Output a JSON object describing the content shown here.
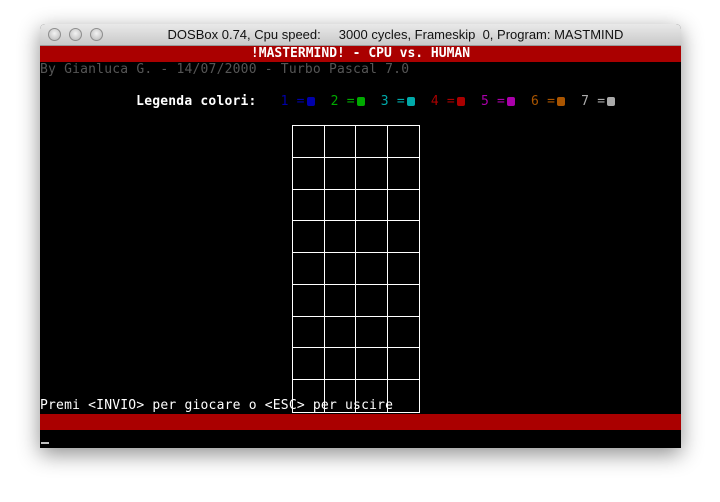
{
  "window": {
    "title": "DOSBox 0.74, Cpu speed:     3000 cycles, Frameskip  0, Program: MASTMIND"
  },
  "screen": {
    "banner": "!MASTERMIND! - CPU vs. HUMAN",
    "credit": "By Gianluca G. - 14/07/2000 - Turbo Pascal 7.0",
    "legend_label": "Legenda colori:",
    "legend": [
      {
        "num": "1",
        "eq": "=",
        "color": "#0000aa"
      },
      {
        "num": "2",
        "eq": "=",
        "color": "#00aa00"
      },
      {
        "num": "3",
        "eq": "=",
        "color": "#00aaaa"
      },
      {
        "num": "4",
        "eq": "=",
        "color": "#aa0000"
      },
      {
        "num": "5",
        "eq": "=",
        "color": "#aa00aa"
      },
      {
        "num": "6",
        "eq": "=",
        "color": "#aa5500"
      },
      {
        "num": "7",
        "eq": "=",
        "color": "#aaaaaa"
      }
    ],
    "prompt": "Premi <INVIO> per giocare o <ESC> per uscire"
  },
  "colors": {
    "banner_bg": "#aa0000",
    "credit": "#555555",
    "text": "#ffffff",
    "background": "#000000"
  },
  "icons": [
    "close-button-icon",
    "minimize-button-icon",
    "zoom-button-icon",
    "peg-icon",
    "text-cursor-icon"
  ]
}
